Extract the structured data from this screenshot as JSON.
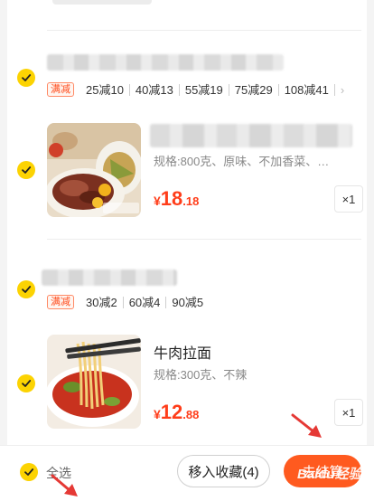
{
  "colors": {
    "accent": "#fcd302",
    "price": "#ff3d1a",
    "primary_button": "#ff5a1f",
    "arrow": "#e53935"
  },
  "store_1": {
    "promo_tag": "满减",
    "promos": [
      "25减10",
      "40减13",
      "55减19",
      "75减29",
      "108减41"
    ]
  },
  "product_1": {
    "spec": "规格:800克、原味、不加香菜、…",
    "currency": "¥",
    "price_int": "18",
    "price_dec": ".18",
    "qty": "×1",
    "image_icon": "roast-meat-platter-image"
  },
  "store_2": {
    "promo_tag": "满减",
    "promos": [
      "30减2",
      "60减4",
      "90减5"
    ]
  },
  "product_2": {
    "title": "牛肉拉面",
    "spec": "规格:300克、不辣",
    "currency": "¥",
    "price_int": "12",
    "price_dec": ".88",
    "qty": "×1",
    "image_icon": "beef-noodle-bowl-image"
  },
  "bottom_bar": {
    "select_all": "全选",
    "move_to_favorites": "移入收藏(4)",
    "settle": "去结算"
  },
  "watermark": "Baidu经验"
}
